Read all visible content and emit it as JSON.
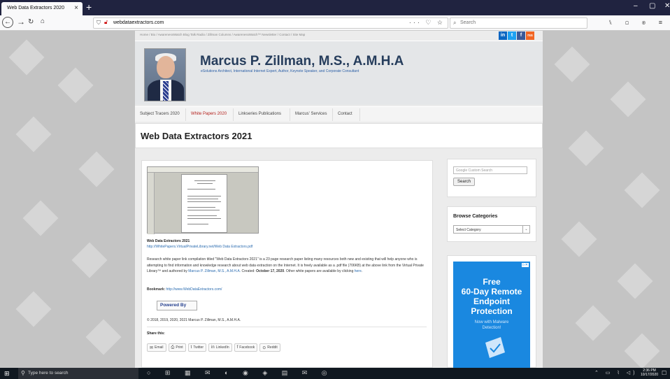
{
  "browser": {
    "tab_title": "Web Data Extractors 2020",
    "tab_close": "×",
    "new_tab": "+",
    "url": "webdataextractors.com",
    "url_icons": "··· ♡ ☆",
    "search_placeholder": "Search",
    "toolbar_icons": "⑊ ▢ ◉ ≡",
    "window_controls": [
      "–",
      "▢",
      "✕"
    ]
  },
  "site": {
    "topnav": "Home  /  Bio  /  AwarenessWatch Blog Talk Radio  /  Zillman Columns  /  AwarenessWatch™ Newsletter  /  Contact  /  Site Map",
    "social": [
      {
        "label": "in",
        "color": "#0a66c2"
      },
      {
        "label": "t",
        "color": "#1da1f2"
      },
      {
        "label": "f",
        "color": "#3b5998"
      },
      {
        "label": "rss",
        "color": "#f26522"
      }
    ],
    "title": "Marcus P. Zillman, M.S., A.M.H.A",
    "tagline": "eSolutions Architect, International Internet Expert, Author, Keynote Speaker, and Corporate Consultant",
    "nav": [
      "Subject Tracers 2020",
      "White Papers 2020",
      "Linkseries Publications",
      "Marcus' Services",
      "Contact"
    ],
    "page_title": "Web Data Extractors 2021"
  },
  "content": {
    "doc_title": "Web Data Extractors 2021",
    "doc_link": "http://WhitePapers.VirtualPrivateLibrary.net/Web Data Extractors.pdf",
    "para_1": "Research white paper link compilation titled \"Web Data Extractors 2021\" is a 23 page research paper listing many resources both new and existing that will help anyone who is attempting to find information and knowledge research about web data extraction on the Internet. It is freely available as a .pdf file (706KB) at the above link from the Virtual Private Library™ and authored by",
    "author_link": "Marcus P. Zillman, M.S., A.M.H.A.",
    "created_label": " Created: ",
    "created_date": "October 17, 2020",
    "para_2": ". Other white papers are available by clicking ",
    "here_link": "here",
    "bookmark_label": "Bookmark:",
    "bookmark_url": "http://www.WebDataExtractors.com/",
    "powered_by": "Powered By",
    "copyright": "© 2018, 2019, 2020, 2021 Marcus P. Zillman, M.S., A.M.H.A.",
    "share_title": "Share this:",
    "share_buttons": [
      {
        "icon": "✉",
        "label": "Email"
      },
      {
        "icon": "⎙",
        "label": "Print"
      },
      {
        "icon": "t",
        "label": "Twitter"
      },
      {
        "icon": "in",
        "label": "LinkedIn"
      },
      {
        "icon": "f",
        "label": "Facebook"
      },
      {
        "icon": "⊙",
        "label": "Reddit"
      }
    ]
  },
  "sidebar": {
    "search_placeholder": "Google Custom Search",
    "search_button": "Search",
    "categories_title": "Browse Categories",
    "categories_selected": "Select Category",
    "ad": {
      "badge": "▷✕",
      "line1": "Free",
      "line2": "60-Day Remote",
      "line3": "Endpoint",
      "line4": "Protection",
      "sub1": "Now with Malware",
      "sub2": "Detection!"
    }
  },
  "taskbar": {
    "search_text": "Type here to search",
    "apps": "○ ⊞ ▦ ✉ ◐ ◉ ◈ ▤ ✉ ◎",
    "tray": "⌃ ▭ ⌇ ◁)",
    "time": "2:36 PM",
    "date": "10/17/2020"
  }
}
